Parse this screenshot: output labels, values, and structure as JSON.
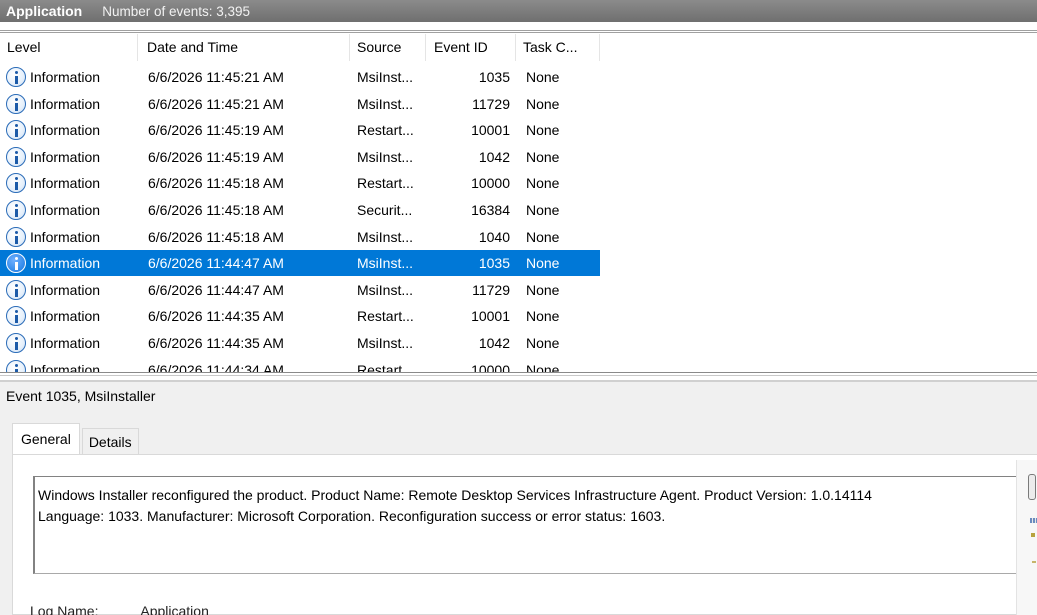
{
  "header": {
    "log_name": "Application",
    "event_count": "Number of events: 3,395"
  },
  "grid": {
    "columns": [
      "Level",
      "Date and Time",
      "Source",
      "Event ID",
      "Task C..."
    ],
    "rows": [
      {
        "level": "Information",
        "date": "6/6/2026 11:45:21 AM",
        "source": "MsiInst...",
        "event_id": "1035",
        "task": "None"
      },
      {
        "level": "Information",
        "date": "6/6/2026 11:45:21 AM",
        "source": "MsiInst...",
        "event_id": "11729",
        "task": "None"
      },
      {
        "level": "Information",
        "date": "6/6/2026 11:45:19 AM",
        "source": "Restart...",
        "event_id": "10001",
        "task": "None"
      },
      {
        "level": "Information",
        "date": "6/6/2026 11:45:19 AM",
        "source": "MsiInst...",
        "event_id": "1042",
        "task": "None"
      },
      {
        "level": "Information",
        "date": "6/6/2026 11:45:18 AM",
        "source": "Restart...",
        "event_id": "10000",
        "task": "None"
      },
      {
        "level": "Information",
        "date": "6/6/2026 11:45:18 AM",
        "source": "Securit...",
        "event_id": "16384",
        "task": "None"
      },
      {
        "level": "Information",
        "date": "6/6/2026 11:45:18 AM",
        "source": "MsiInst...",
        "event_id": "1040",
        "task": "None"
      },
      {
        "level": "Information",
        "date": "6/6/2026 11:44:47 AM",
        "source": "MsiInst...",
        "event_id": "1035",
        "task": "None",
        "selected": true
      },
      {
        "level": "Information",
        "date": "6/6/2026 11:44:47 AM",
        "source": "MsiInst...",
        "event_id": "11729",
        "task": "None"
      },
      {
        "level": "Information",
        "date": "6/6/2026 11:44:35 AM",
        "source": "Restart...",
        "event_id": "10001",
        "task": "None"
      },
      {
        "level": "Information",
        "date": "6/6/2026 11:44:35 AM",
        "source": "MsiInst...",
        "event_id": "1042",
        "task": "None"
      },
      {
        "level": "Information",
        "date": "6/6/2026 11:44:34 AM",
        "source": "Restart...",
        "event_id": "10000",
        "task": "None"
      }
    ],
    "icon": "information-icon",
    "selection_color": "#0078d7"
  },
  "detail": {
    "title": "Event 1035, MsiInstaller",
    "tabs": [
      "General",
      "Details"
    ],
    "active_tab": "General",
    "description_line1": "Windows Installer reconfigured the product. Product Name: Remote Desktop Services Infrastructure Agent. Product Version: 1.0.14114",
    "description_line2": "Language: 1033. Manufacturer: Microsoft Corporation. Reconfiguration success or error status: 1603.",
    "partial_field_label": "Log Name:",
    "partial_field_value": "Application"
  }
}
